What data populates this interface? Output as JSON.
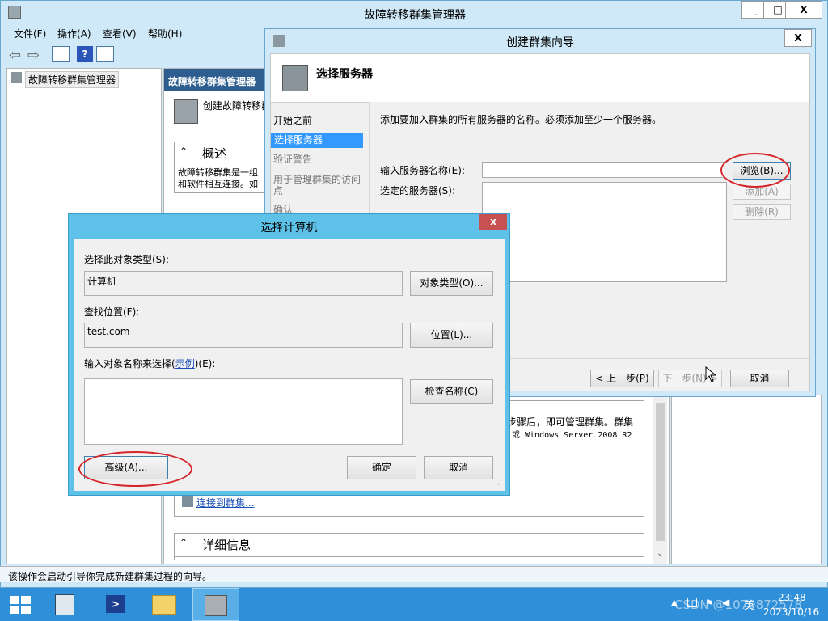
{
  "main": {
    "title": "故障转移群集管理器",
    "window_buttons": [
      "_",
      "□",
      "X"
    ],
    "menu": [
      "文件(F)",
      "操作(A)",
      "查看(V)",
      "帮助(H)"
    ],
    "tree_root": "故障转移群集管理器",
    "center_header": "故障转移群集管理器",
    "create_cluster_link": "创建故障转移群",
    "overview_title": "概述",
    "overview_text": "故障转移群集是一组",
    "overview_text2": "和软件相互连接。如",
    "right_text1": "步骤后，即可管理群集。群集",
    "right_text2": "或 Windows Server 2008 R2",
    "connect_link": "连接到群集...",
    "details_title": "详细信息",
    "status_bar": "该操作会启动引导你完成新建群集过程的向导。"
  },
  "wizard": {
    "title": "创建群集向导",
    "close": "X",
    "page_title": "选择服务器",
    "steps": [
      "开始之前",
      "选择服务器",
      "验证警告",
      "用于管理群集的访问点",
      "确认"
    ],
    "instruction": "添加要加入群集的所有服务器的名称。必须添加至少一个服务器。",
    "server_name_label": "输入服务器名称(E):",
    "selected_label": "选定的服务器(S):",
    "browse": "浏览(B)...",
    "add": "添加(A)",
    "remove": "删除(R)",
    "prev": "< 上一步(P)",
    "next": "下一步(N) >",
    "cancel": "取消"
  },
  "dialog": {
    "title": "选择计算机",
    "close": "x",
    "object_type_label": "选择此对象类型(S):",
    "object_type_value": "计算机",
    "object_type_btn": "对象类型(O)...",
    "location_label": "查找位置(F):",
    "location_value": "test.com",
    "location_btn": "位置(L)...",
    "name_label_a": "输入对象名称来选择(",
    "name_label_link": "示例",
    "name_label_b": ")(E):",
    "check_btn": "检查名称(C)",
    "advanced": "高级(A)...",
    "ok": "确定",
    "cancel": "取消"
  },
  "taskbar": {
    "time": "23:48",
    "date": "2023/10/16",
    "ime": "英",
    "watermark": "CSDN @1079872578"
  },
  "colors": {
    "titlebar": "#cfe9f8",
    "dialog": "#5ec2e8",
    "taskbar": "#2f8fd8",
    "annotation": "#d6262a"
  }
}
